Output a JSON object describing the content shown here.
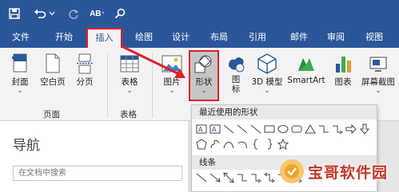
{
  "quick_access": {
    "save_icon": "save-icon",
    "undo_icon": "undo-icon",
    "undo_dropdown_icon": "chevron-down-icon",
    "redo_icon": "redo-icon",
    "format_icon": "ab-format-icon",
    "format_label": "AB",
    "search_icon": "search-icon"
  },
  "tabs": [
    {
      "label": "文件"
    },
    {
      "label": "开始"
    },
    {
      "label": "插入",
      "active": true
    },
    {
      "label": "绘图"
    },
    {
      "label": "设计"
    },
    {
      "label": "布局"
    },
    {
      "label": "引用"
    },
    {
      "label": "邮件"
    },
    {
      "label": "审阅"
    },
    {
      "label": "视图"
    }
  ],
  "ribbon": {
    "pages_group": {
      "label": "页面",
      "buttons": [
        {
          "label": "封面",
          "icon": "cover-page-icon",
          "has_dropdown": true
        },
        {
          "label": "空白页",
          "icon": "blank-page-icon"
        },
        {
          "label": "分页",
          "icon": "page-break-icon"
        }
      ]
    },
    "tables_group": {
      "label": "表格",
      "buttons": [
        {
          "label": "表格",
          "icon": "table-icon",
          "has_dropdown": true
        }
      ]
    },
    "illustrations": {
      "buttons": [
        {
          "label": "图片",
          "icon": "picture-icon",
          "has_dropdown": true
        },
        {
          "label": "形状",
          "icon": "shapes-icon",
          "has_dropdown": true,
          "highlighted": true
        },
        {
          "label": "图标",
          "label_line2": "标",
          "icon": "icons-icon"
        },
        {
          "label": "3D 模型",
          "label_line2": "型",
          "icon": "3d-model-icon",
          "has_dropdown": true
        },
        {
          "label": "SmartArt",
          "icon": "smartart-icon"
        },
        {
          "label": "图表",
          "icon": "chart-icon"
        },
        {
          "label": "屏幕截图",
          "icon": "screenshot-icon",
          "has_dropdown": true
        }
      ]
    }
  },
  "navigation_pane": {
    "title": "导航",
    "search_placeholder": "在文档中搜索"
  },
  "shapes_dropdown": {
    "recent_header": "最近使用的形状",
    "lines_header": "线条"
  },
  "watermark": {
    "text": "宝哥软件园"
  },
  "colors": {
    "title_bar": "#2b579a",
    "highlight_red": "#e0202a",
    "ribbon_bg": "#f3f3f3"
  }
}
